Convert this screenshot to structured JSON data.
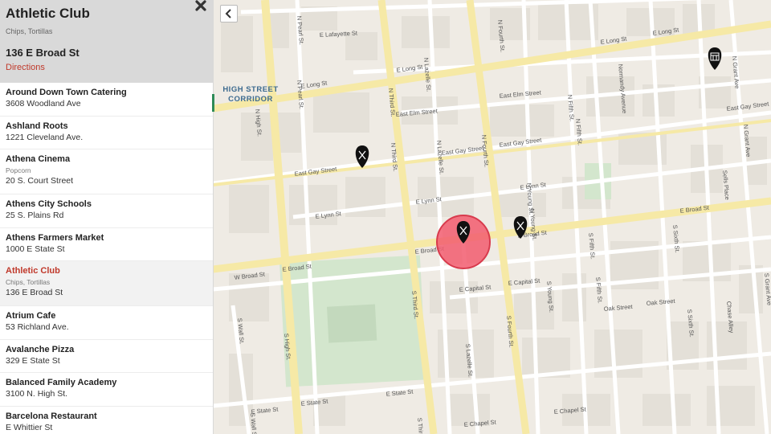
{
  "detail": {
    "title": "Athletic Club",
    "subtitle": "Chips, Tortillas",
    "address": "136 E Broad St",
    "directions": "Directions"
  },
  "list": [
    {
      "name": "Around Down Town Catering",
      "tags": "",
      "address": "3608 Woodland Ave"
    },
    {
      "name": "Ashland Roots",
      "tags": "",
      "address": "1221 Cleveland Ave."
    },
    {
      "name": "Athena Cinema",
      "tags": "Popcorn",
      "address": "20 S. Court Street"
    },
    {
      "name": "Athens City Schools",
      "tags": "",
      "address": "25 S. Plains Rd"
    },
    {
      "name": "Athens Farmers Market",
      "tags": "",
      "address": "1000 E State St"
    },
    {
      "name": "Athletic Club",
      "tags": "Chips, Tortillas",
      "address": "136 E Broad St",
      "active": true
    },
    {
      "name": "Atrium Cafe",
      "tags": "",
      "address": "53 Richland Ave."
    },
    {
      "name": "Avalanche Pizza",
      "tags": "",
      "address": "329 E State St"
    },
    {
      "name": "Balanced Family Academy",
      "tags": "",
      "address": "3100 N. High St."
    },
    {
      "name": "Barcelona Restaurant",
      "tags": "",
      "address": "E Whittier St"
    }
  ],
  "map": {
    "area_label_line1": "HIGH STREET",
    "area_label_line2": "CORRIDOR",
    "streets": {
      "e_lafayette": "E Lafayette St",
      "e_long_1": "E Long St",
      "e_long_2": "E Long St",
      "e_long_3": "E Long St",
      "e_long_4": "E Long St",
      "e_elm": "East Elm Street",
      "e_elm_2": "East Elm Street",
      "e_gay_1": "East Gay Street",
      "e_gay_2": "East Gay Street",
      "e_gay_3": "East Gay Street",
      "e_gay_4": "East Gay Street",
      "e_lynn_1": "E Lynn St",
      "e_lynn_2": "E Lynn St",
      "e_lynn_3": "E Lynn St",
      "w_broad": "W Broad St",
      "e_broad_1": "E Broad St",
      "e_broad_2": "E Broad St",
      "e_broad_3": "E Broad St",
      "e_broad_4": "E Broad St",
      "e_capital_1": "E Capital St",
      "e_capital_2": "E Capital St",
      "oak_1": "Oak Street",
      "oak_2": "Oak Street",
      "e_state_1": "E State St",
      "e_state_2": "E State St",
      "e_state_3": "E State St",
      "e_chapel_1": "E Chapel St",
      "e_chapel_2": "E Chapel St",
      "n_high": "N High St.",
      "n_pearl_1": "N Pearl St.",
      "n_pearl_2": "N Pearl St.",
      "n_third_1": "N Third St.",
      "n_third_2": "N Third St.",
      "n_lazelle_1": "N Lazelle St.",
      "n_lazelle_2": "N Lazelle St.",
      "n_fourth_1": "N Fourth St.",
      "n_fourth_2": "N Fourth St.",
      "n_fifth_1": "N Fifth St.",
      "n_fifth_2": "N Fifth St.",
      "normandy": "Normandy Avenue",
      "n_grant_1": "N Grant Ave",
      "n_grant_2": "N Grant Ave",
      "n_young_1": "N Young St.",
      "n_young_2": "N Young St.",
      "s_high": "S High St.",
      "s_wall_1": "S Wall St.",
      "s_wall_2": "S Wall St.",
      "s_third_1": "S Third St.",
      "s_third_2": "S Third St.",
      "s_lazelle": "S Lazelle St.",
      "s_fourth": "S Fourth St.",
      "s_young": "S Young St.",
      "s_fifth_1": "S Fifth St.",
      "s_fifth_2": "S Fifth St.",
      "s_sixth_1": "S Sixth St.",
      "s_sixth_2": "S Sixth St.",
      "s_grant": "S Grant Ave",
      "chase_alley": "Chase Alley",
      "sells_place": "Sells Place"
    },
    "markers": [
      {
        "name": "restaurant-marker",
        "icon": "fork-knife-icon"
      },
      {
        "name": "restaurant-marker",
        "icon": "fork-knife-icon"
      },
      {
        "name": "restaurant-marker",
        "icon": "fork-knife-icon"
      },
      {
        "name": "store-marker",
        "icon": "store-icon"
      }
    ],
    "highlight_color": "#f25c6f",
    "accent_color": "#c0392b"
  }
}
